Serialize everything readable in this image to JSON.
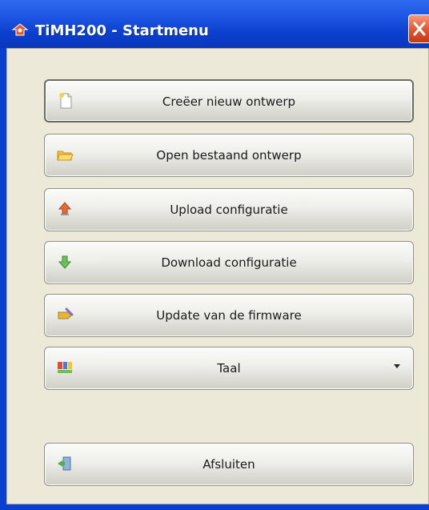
{
  "window": {
    "title": "TiMH200 - Startmenu",
    "icon": "app-icon",
    "close_icon": "close-icon"
  },
  "menu": {
    "buttons": [
      {
        "label": "Creëer nieuw ontwerp",
        "icon": "new-document-icon"
      },
      {
        "label": "Open bestaand ontwerp",
        "icon": "open-folder-icon"
      },
      {
        "label": "Upload configuratie",
        "icon": "upload-icon"
      },
      {
        "label": "Download configuratie",
        "icon": "download-icon"
      },
      {
        "label": "Update van de firmware",
        "icon": "firmware-update-icon"
      },
      {
        "label": "Taal",
        "icon": "language-flags-icon",
        "has_dropdown": true
      },
      {
        "label": "Afsluiten",
        "icon": "exit-door-icon"
      }
    ]
  },
  "colors": {
    "titlebar": "#0b3fce",
    "client_bg": "#ece9d8",
    "close_button": "#e0552e"
  }
}
